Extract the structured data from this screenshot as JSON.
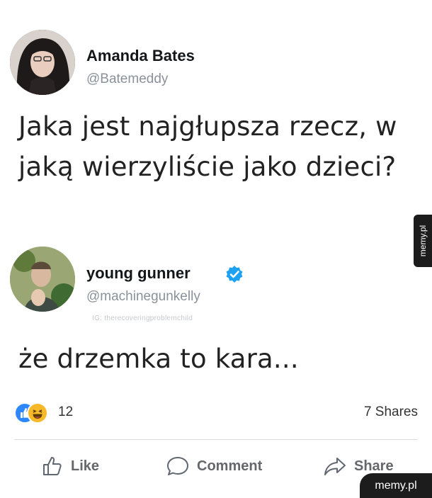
{
  "tweet1": {
    "name": "Amanda Bates",
    "handle": "@Batemeddy",
    "text": "Jaka jest najgłupsza rzecz, w jaką wierzyliście jako dzieci?"
  },
  "tweet2": {
    "name": "young gunner",
    "handle": "@machinegunkelly",
    "ig_credit": "IG: therecoveringproblemchild",
    "text": "że drzemka to kara..."
  },
  "side_tab": "memy.pl",
  "reactions": {
    "count": "12",
    "icons": [
      "like-icon",
      "haha-icon"
    ]
  },
  "shares": "7 Shares",
  "actions": {
    "like": "Like",
    "comment": "Comment",
    "share": "Share"
  },
  "brand": "memy.pl",
  "colors": {
    "like_blue": "#2d88ff",
    "haha_yellow": "#f7b928",
    "verified_blue": "#1da1f2",
    "tab_bg": "#1c1c1c"
  }
}
